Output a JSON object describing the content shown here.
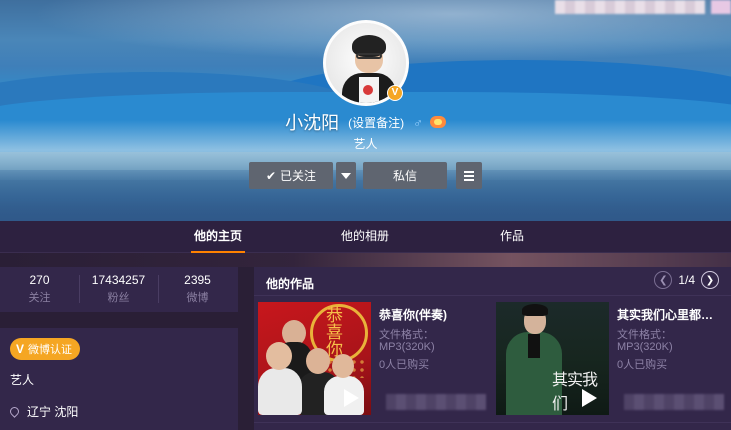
{
  "profile": {
    "name": "小沈阳",
    "remark": "(设置备注)",
    "gender_icon": "male-icon",
    "verified_badge": "V",
    "description": "艺人"
  },
  "actions": {
    "follow_label": "已关注",
    "message_label": "私信"
  },
  "tabs": [
    {
      "label": "他的主页",
      "active": true
    },
    {
      "label": "他的相册",
      "active": false
    },
    {
      "label": "作品",
      "active": false
    }
  ],
  "stats": [
    {
      "value": "270",
      "label": "关注"
    },
    {
      "value": "17434257",
      "label": "粉丝"
    },
    {
      "value": "2395",
      "label": "微博"
    }
  ],
  "info": {
    "verify_tag": "微博认证",
    "verify_letter": "V",
    "title": "艺人",
    "location": "辽宁 沈阳"
  },
  "works": {
    "title": "他的作品",
    "page": "1/4",
    "items": [
      {
        "title": "恭喜你(伴奏)",
        "format": "文件格式：",
        "quality": "MP3(320K)",
        "buyers": "0人已购买",
        "cover_text": "恭喜你"
      },
      {
        "title": "其实我们心里都…",
        "format": "文件格式：",
        "quality": "MP3(320K)",
        "buyers": "0人已购买",
        "cover_text": "其实我们"
      }
    ]
  },
  "colors": {
    "accent": "#ff8200",
    "verified": "#f5a623",
    "panel": "#33274a",
    "page_bg": "#2a1f36"
  }
}
